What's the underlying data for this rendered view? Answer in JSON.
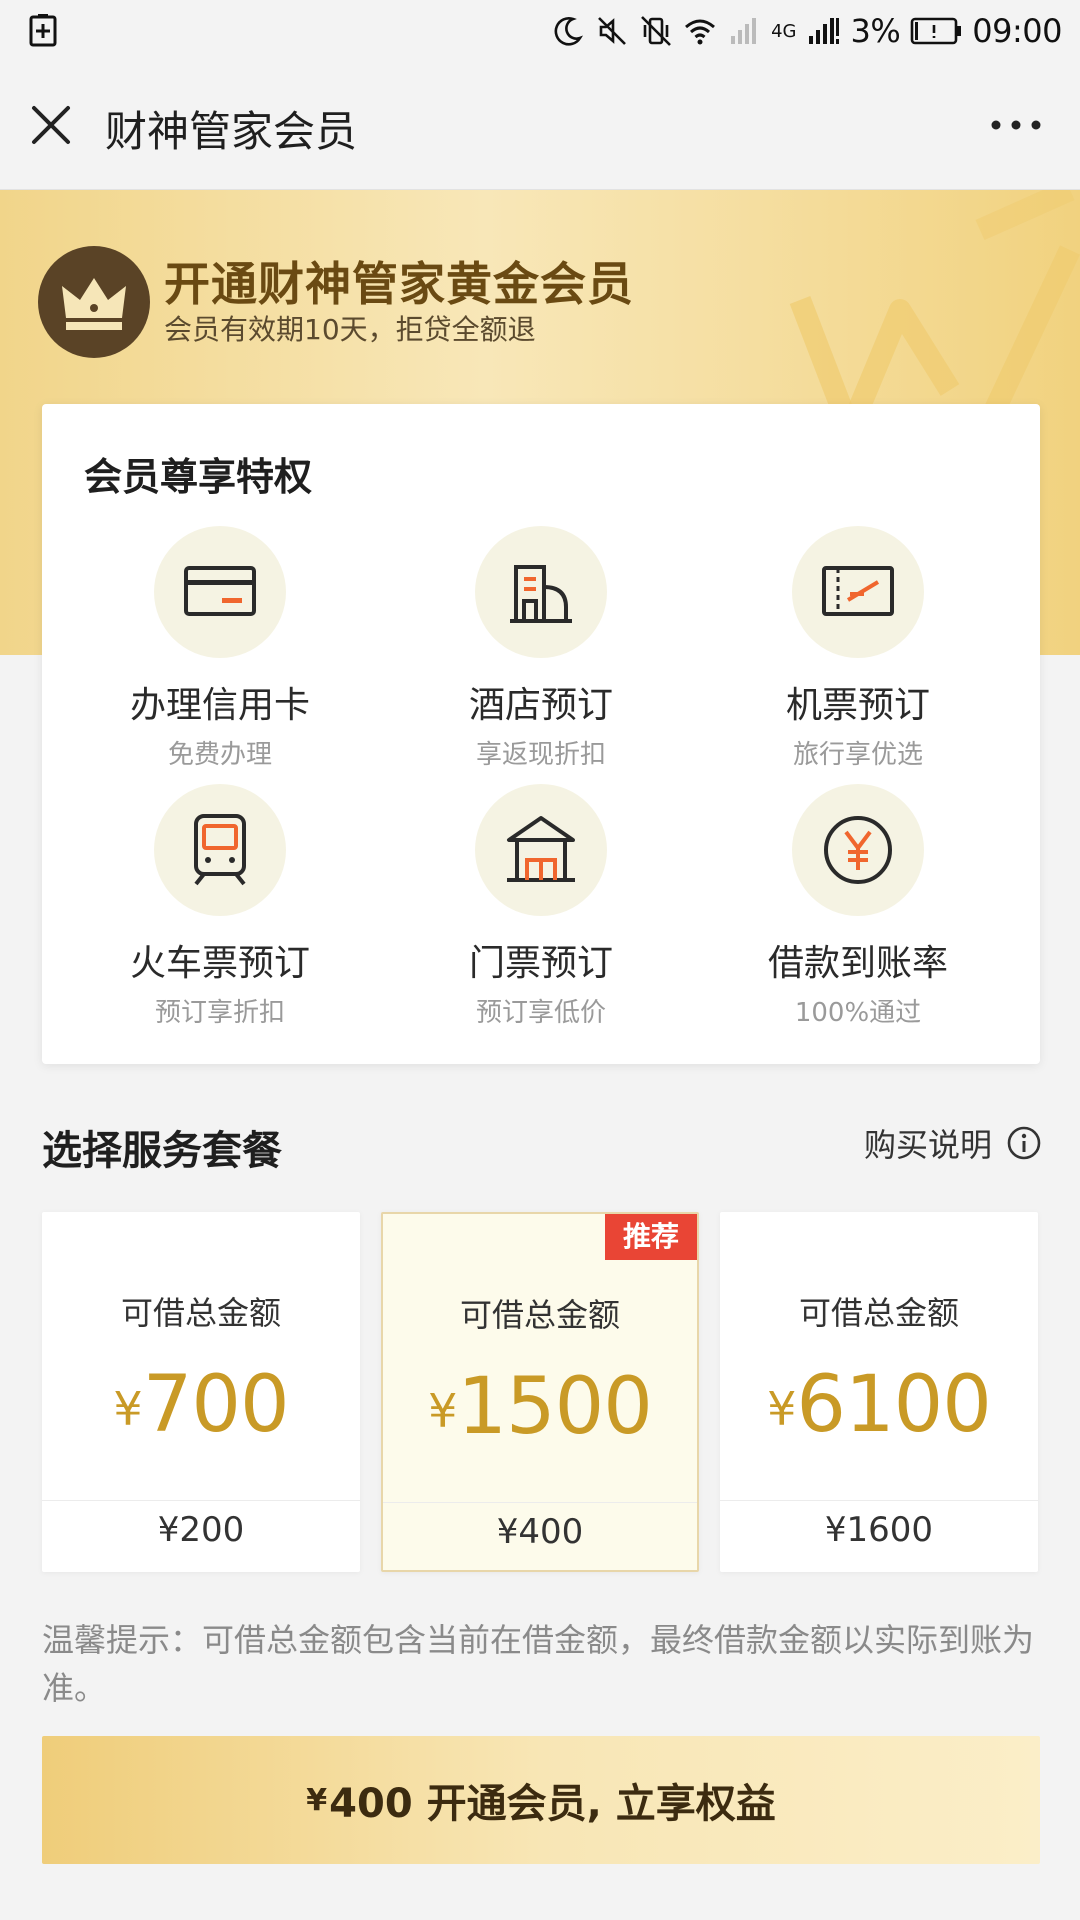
{
  "status_bar": {
    "network": "4G",
    "battery_percent": "3%",
    "time": "09:00"
  },
  "title_bar": {
    "title": "财神管家会员"
  },
  "hero": {
    "title": "开通财神管家黄金会员",
    "subtitle": "会员有效期10天，拒贷全额退"
  },
  "privileges": {
    "title": "会员尊享特权",
    "items": [
      {
        "name": "办理信用卡",
        "desc": "免费办理",
        "icon": "credit-card-icon"
      },
      {
        "name": "酒店预订",
        "desc": "享返现折扣",
        "icon": "hotel-icon"
      },
      {
        "name": "机票预订",
        "desc": "旅行享优选",
        "icon": "flight-ticket-icon"
      },
      {
        "name": "火车票预订",
        "desc": "预订享折扣",
        "icon": "train-icon"
      },
      {
        "name": "门票预订",
        "desc": "预订享低价",
        "icon": "pavilion-icon"
      },
      {
        "name": "借款到账率",
        "desc": "100%通过",
        "icon": "yen-circle-icon"
      }
    ]
  },
  "packages": {
    "title": "选择服务套餐",
    "buy_info": "购买说明",
    "badge": "推荐",
    "currency": "¥",
    "items": [
      {
        "label": "可借总金额",
        "amount": "700",
        "fee": "¥200"
      },
      {
        "label": "可借总金额",
        "amount": "1500",
        "fee": "¥400"
      },
      {
        "label": "可借总金额",
        "amount": "6100",
        "fee": "¥1600"
      }
    ]
  },
  "tip": "温馨提示：可借总金额包含当前在借金额，最终借款金额以实际到账为准。",
  "cta": {
    "currency": "¥",
    "label": "400 开通会员, 立享权益"
  },
  "colors": {
    "gold": "#c99a26",
    "brown": "#5a4326",
    "badge_red": "#e94535",
    "accent_orange": "#f0662e"
  }
}
